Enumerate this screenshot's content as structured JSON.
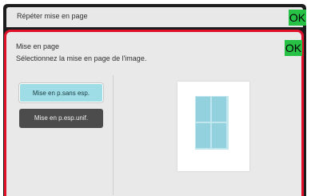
{
  "header": {
    "title": "Répéter mise en page",
    "ok_label": "OK"
  },
  "panel": {
    "title": "Mise en page",
    "subtitle": "Sélectionnez la mise en page de l'image.",
    "ok_label": "OK",
    "options": [
      {
        "label": "Mise en p.sans esp.",
        "selected": true
      },
      {
        "label": "Mise en p.esp.unif.",
        "selected": false
      }
    ]
  },
  "colors": {
    "ok_green": "#27c245",
    "active_border": "#e0102a",
    "selected_option": "#9fdde6",
    "unselected_option": "#4c4c4c",
    "preview_cell": "#93d1df"
  }
}
